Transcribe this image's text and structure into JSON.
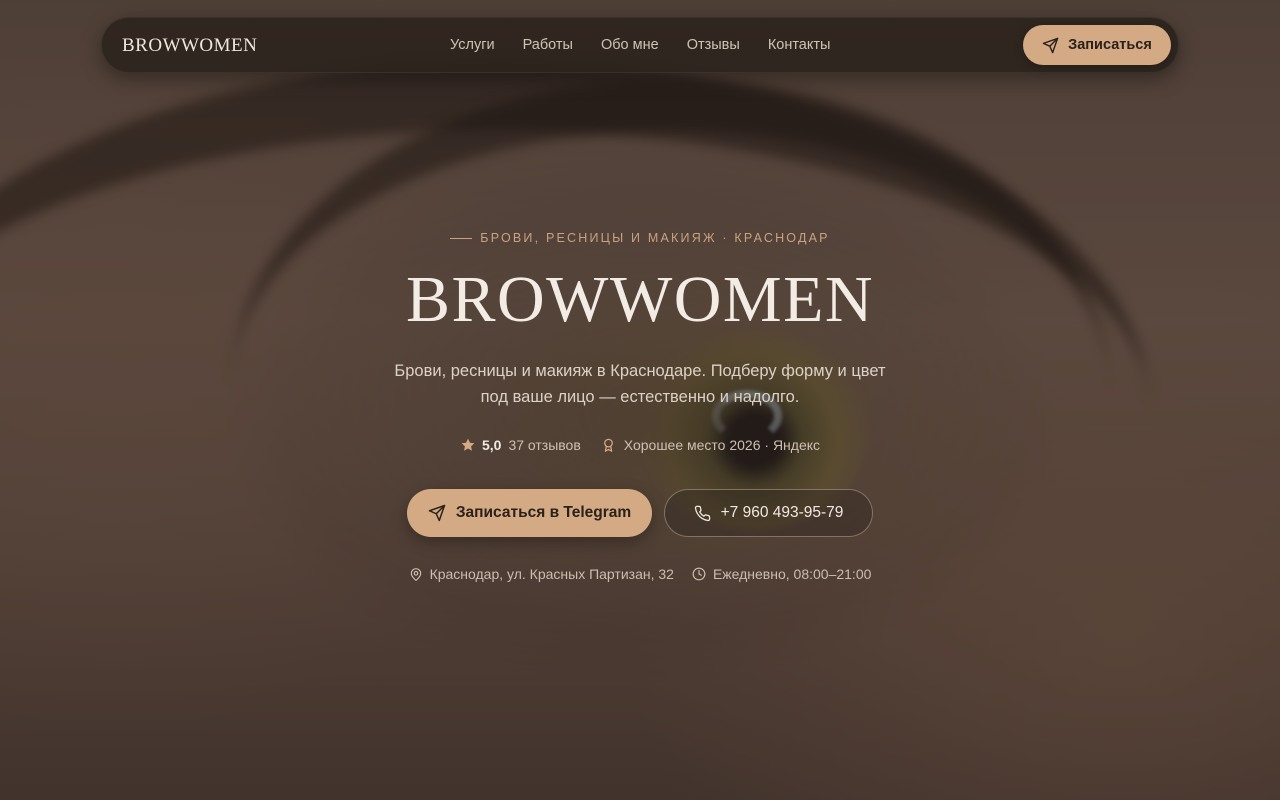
{
  "brand": {
    "logo": "BROWWOMEN"
  },
  "nav": {
    "links": [
      "Услуги",
      "Работы",
      "Обо мне",
      "Отзывы",
      "Контакты"
    ],
    "cta_label": "Записаться"
  },
  "hero": {
    "eyebrow": "БРОВИ, РЕСНИЦЫ И МАКИЯЖ · КРАСНОДАР",
    "title": "BROWWOMEN",
    "subtitle": "Брови, ресницы и макияж в Краснодаре. Подберу форму и цвет под ваше лицо — естественно и надолго.",
    "rating_value": "5,0",
    "reviews": "37 отзывов",
    "award": "Хорошее место 2026 · Яндекс",
    "primary_button": "Записаться в Telegram",
    "phone": "+7 960 493-95-79",
    "address": "Краснодар, ул. Красных Партизан, 32",
    "hours": "Ежедневно, 08:00–21:00"
  },
  "icons": {
    "nav_cta": "send-icon",
    "rating": "star-icon",
    "award": "award-icon",
    "primary_button": "send-icon",
    "phone": "phone-icon",
    "address": "map-pin-icon",
    "hours": "clock-icon"
  },
  "colors": {
    "accent": "#d4aa84",
    "eyebrow": "#c9a280",
    "nav_bg": "#2b221d"
  }
}
